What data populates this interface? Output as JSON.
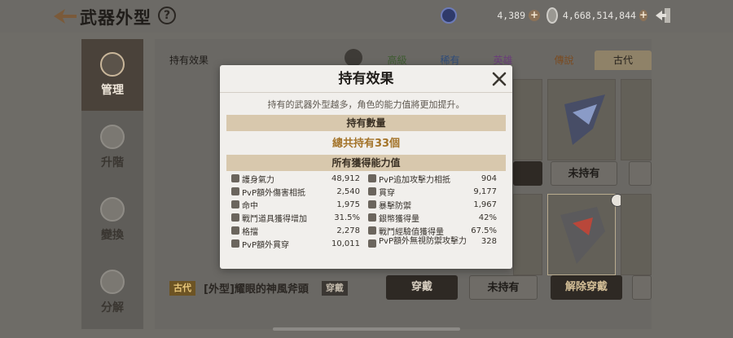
{
  "header": {
    "title": "武器外型",
    "help": "?"
  },
  "currency": [
    {
      "icon": "diamond-currency-icon",
      "value": "4,389"
    },
    {
      "icon": "coin-currency-icon",
      "value": "4,668,514,844"
    }
  ],
  "sidebar": {
    "items": [
      {
        "label": "管理",
        "icon": "manage-icon",
        "active": true
      },
      {
        "label": "升階",
        "icon": "upgrade-icon"
      },
      {
        "label": "變換",
        "icon": "transform-icon"
      },
      {
        "label": "分解",
        "icon": "disassemble-icon"
      }
    ]
  },
  "content": {
    "hold_label": "持有效果",
    "tabs": [
      "高級",
      "稀有",
      "英雄",
      "傳說",
      "古代"
    ],
    "active_tab": "古代",
    "tab_colors": [
      "#3d5c2f",
      "#2f4c7a",
      "#6a3d7a",
      "#7a4b21",
      "#8a5a16"
    ],
    "card_buttons_row1": [
      "未持有"
    ],
    "card_buttons_row2": [
      "穿戴",
      "未持有",
      "解除穿戴"
    ],
    "selected_item": {
      "grade": "古代",
      "name": "[外型]耀眼的神風斧頭",
      "status": "穿戴"
    }
  },
  "modal": {
    "title": "持有效果",
    "description": "持有的武器外型越多，角色的能力值將更加提升。",
    "count_header": "持有數量",
    "count_total": "總共持有33個",
    "stats_header": "所有獲得能力值",
    "stats_left": [
      {
        "label": "護身氣力",
        "value": "48,912"
      },
      {
        "label": "PvP額外傷害相抵",
        "value": "2,540"
      },
      {
        "label": "命中",
        "value": "1,975"
      },
      {
        "label": "戰鬥道具獲得增加",
        "value": "31.5%"
      },
      {
        "label": "格擋",
        "value": "2,278"
      },
      {
        "label": "PvP額外貫穿",
        "value": "10,011"
      }
    ],
    "stats_right": [
      {
        "label": "PvP追加攻擊力相抵",
        "value": "904"
      },
      {
        "label": "貫穿",
        "value": "9,177"
      },
      {
        "label": "暴擊防禦",
        "value": "1,967"
      },
      {
        "label": "銀幣獲得量",
        "value": "42%"
      },
      {
        "label": "戰鬥經驗值獲得量",
        "value": "67.5%"
      },
      {
        "label": "PvP額外無視防禦攻擊力",
        "value": "328"
      }
    ]
  }
}
